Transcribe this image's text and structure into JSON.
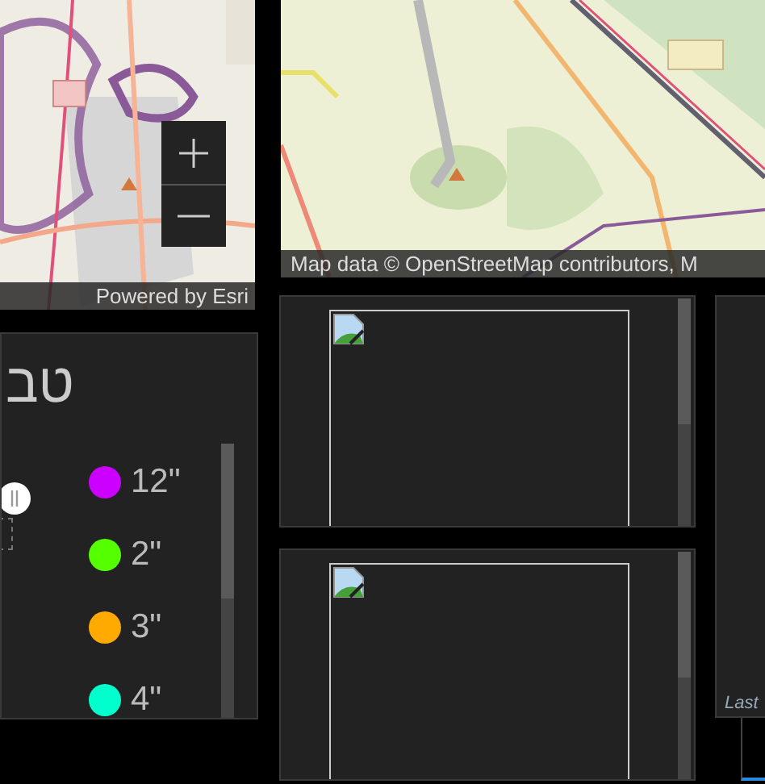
{
  "left_map": {
    "zoom_buttons": [
      {
        "kind": "plus"
      },
      {
        "kind": "minus"
      }
    ],
    "attribution": "Powered by Esri"
  },
  "right_map": {
    "attribution": "Map data © OpenStreetMap contributors, M"
  },
  "legend": {
    "title": "טב",
    "items": [
      {
        "label": "12\"",
        "color": "#cc00ff"
      },
      {
        "label": "2\"",
        "color": "#55ff00"
      },
      {
        "label": "3\"",
        "color": "#ffaa00"
      },
      {
        "label": "4\"",
        "color": "#00ffcc"
      }
    ]
  },
  "media_panels": [
    {
      "kind": "broken-image"
    },
    {
      "kind": "broken-image"
    }
  ],
  "side_panel": {
    "footer": "Last"
  }
}
